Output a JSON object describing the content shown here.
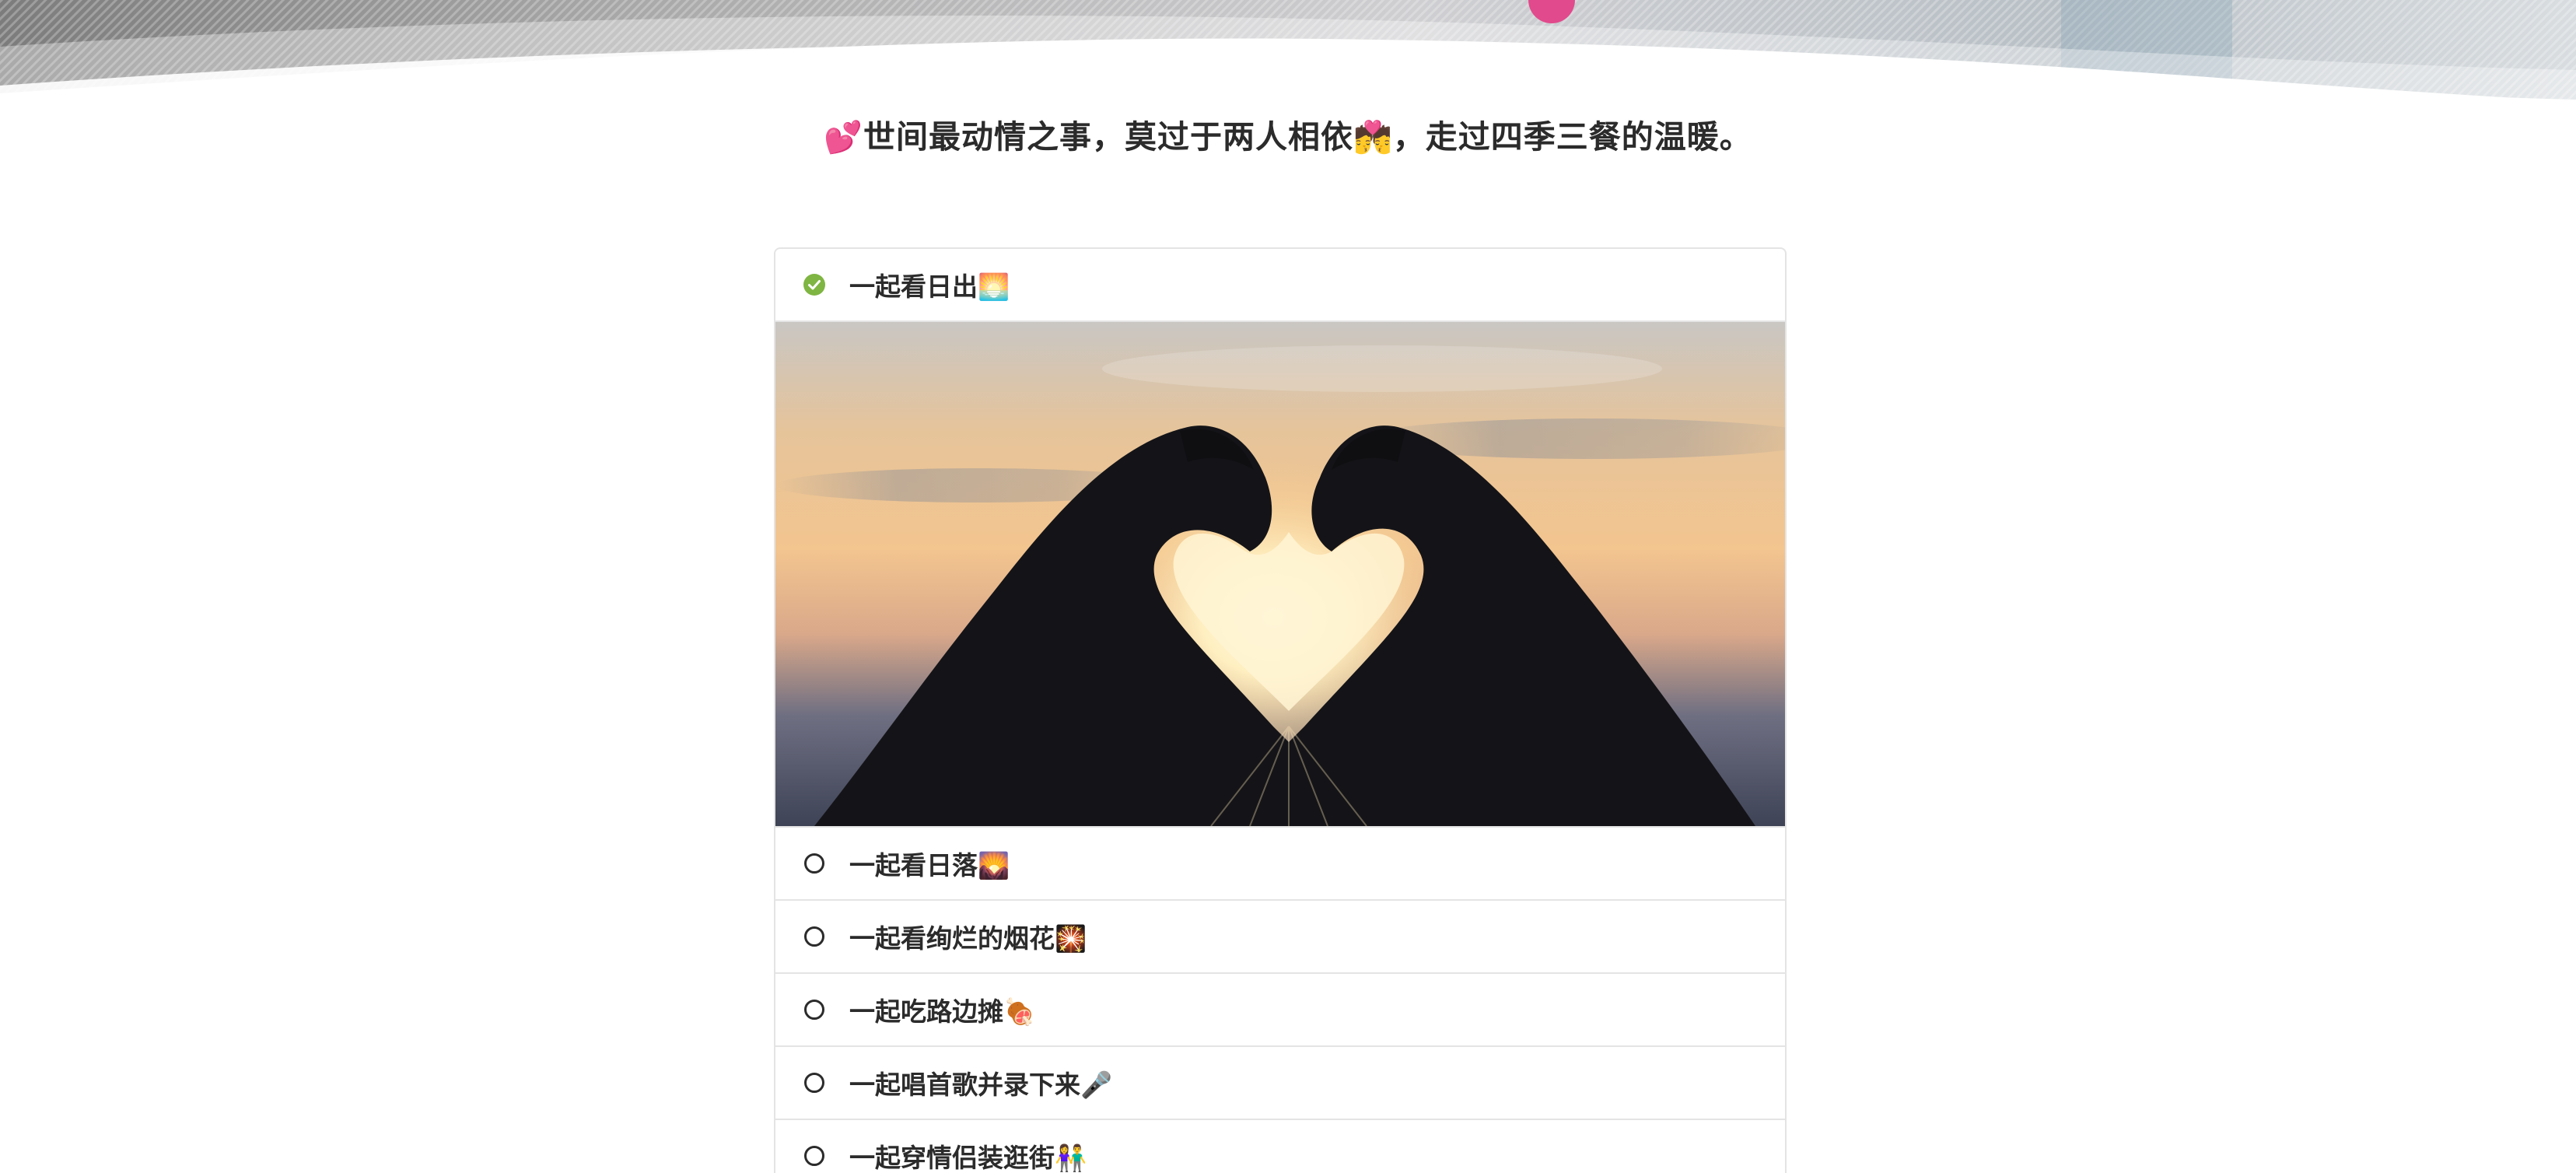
{
  "headline": {
    "emoji_left": "💕",
    "text_a": "世间最动情之事，莫过于两人相依",
    "emoji_mid": "💏",
    "text_b": "，走过四季三餐的温暖。"
  },
  "checklist": {
    "items": [
      {
        "label": "一起看日出🌅",
        "done": true
      },
      {
        "label": "一起看日落🌄",
        "done": false
      },
      {
        "label": "一起看绚烂的烟花🎇",
        "done": false
      },
      {
        "label": "一起吃路边摊🍖",
        "done": false
      },
      {
        "label": "一起唱首歌并录下来🎤",
        "done": false
      },
      {
        "label": "一起穿情侣装逛街👫",
        "done": false
      }
    ]
  },
  "colors": {
    "done_check": "#7fb542",
    "text": "#2b2b2b",
    "border": "#e4e4e4"
  }
}
